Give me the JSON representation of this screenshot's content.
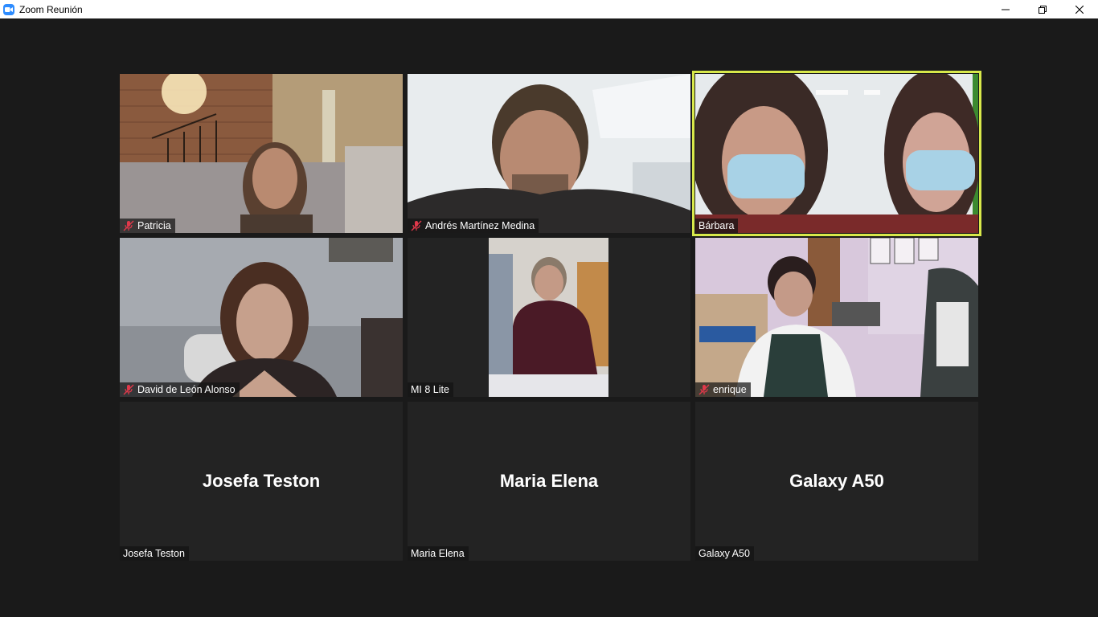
{
  "window": {
    "title": "Zoom Reunión",
    "app_icon": "zoom-camera-icon",
    "controls": [
      "minimize-icon",
      "restore-icon",
      "close-icon"
    ]
  },
  "accent_colors": {
    "active_speaker_border": "#d8e84a",
    "muted_icon": "#e0384a",
    "background": "#1a1a1a",
    "tile_background": "#232323"
  },
  "participants": [
    {
      "name": "Patricia",
      "muted": true,
      "video": true
    },
    {
      "name": "Andrés Martínez Medina",
      "muted": true,
      "video": true
    },
    {
      "name": "Bárbara",
      "muted": false,
      "video": true,
      "active_speaker": true
    },
    {
      "name": "David de León Alonso",
      "muted": true,
      "video": true
    },
    {
      "name": "MI 8 Lite",
      "muted": false,
      "video": true
    },
    {
      "name": "enrique",
      "muted": true,
      "video": true
    },
    {
      "name": "Josefa Teston",
      "muted": false,
      "video": false
    },
    {
      "name": "Maria Elena",
      "muted": false,
      "video": false
    },
    {
      "name": "Galaxy A50",
      "muted": false,
      "video": false
    }
  ]
}
